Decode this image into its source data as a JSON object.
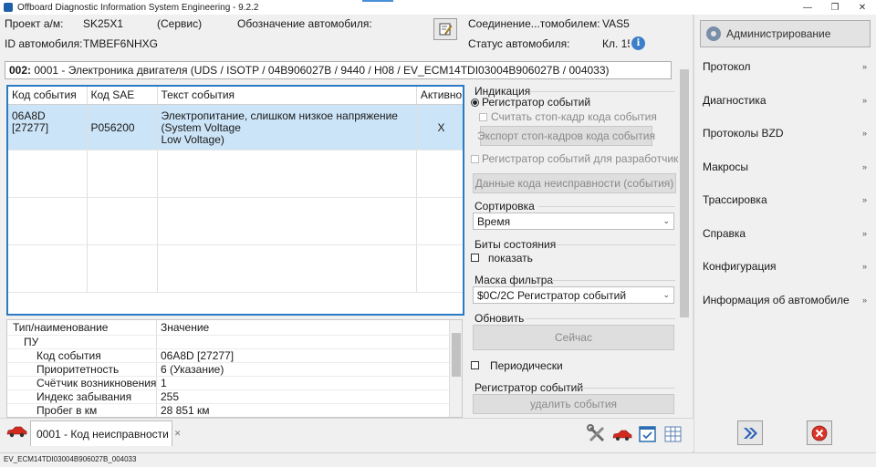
{
  "window": {
    "title": "Offboard Diagnostic Information System Engineering - 9.2.2",
    "minimize": "—",
    "restore": "❐",
    "close": "✕"
  },
  "header": {
    "project_label": "Проект а/м:",
    "project_value": "SK25X1",
    "project_mode": "(Сервис)",
    "designation_label": "Обозначение автомобиля:",
    "vehicle_id_label": "ID автомобиля:",
    "vehicle_id_value": "TMBEF6NHXG",
    "connection_label": "Соединение...томобилем:",
    "connection_value": "VAS5",
    "status_label": "Статус автомобиля:",
    "status_value": "Кл. 15",
    "info_glyph": "i"
  },
  "module_path": {
    "number": "002:",
    "text": "0001 - Электроника двигателя  (UDS / ISOTP / 04B906027B / 9440 / H08 / EV_ECM14TDI03004B906027B / 004033)"
  },
  "events_table": {
    "columns": [
      "Код события",
      "Код SAE",
      "Текст события",
      "Активно"
    ],
    "rows": [
      {
        "code_line1": "06A8D",
        "code_line2": "[27277]",
        "sae": "P056200",
        "text_line1": "Электропитание, слишком низкое напряжение",
        "text_line2": "(System Voltage",
        "text_line3": "Low Voltage)",
        "active": "X"
      }
    ]
  },
  "details_table": {
    "col1": "Тип/наименование",
    "col2": "Значение",
    "group": "ПУ",
    "rows": [
      {
        "name": "Код события",
        "value": "06A8D [27277]"
      },
      {
        "name": "Приоритетность",
        "value": "6 (Указание)"
      },
      {
        "name": "Счётчик возникновения от",
        "value": "1"
      },
      {
        "name": "Индекс забывания",
        "value": "255"
      },
      {
        "name": "Пробег в км",
        "value": "28 851 км"
      }
    ]
  },
  "options": {
    "indication_label": "Индикация",
    "event_recorder": "Регистратор событий",
    "read_freeze_frame": "Считать стоп-кадр кода события",
    "export_freeze_frames": "Экспорт стоп-кадров кода события",
    "dev_recorder": "Регистратор событий для разработчиков",
    "fault_data": "Данные кода неисправности (события)",
    "sort_label": "Сортировка",
    "sort_value": "Время",
    "status_bits_label": "Биты состояния",
    "show_label": "показать",
    "filter_mask_label": "Маска фильтра",
    "filter_mask_value": "$0C/2C Регистратор событий",
    "refresh_label": "Обновить",
    "now_button": "Сейчас",
    "periodic_label": "Периодически",
    "recorder_group_label": "Регистратор событий",
    "delete_events": "удалить события",
    "combo_arrow": "⌄"
  },
  "sidebar": {
    "admin_button": "Администрирование",
    "chevron": "»",
    "items": [
      "Протокол",
      "Диагностика",
      "Протоколы BZD",
      "Макросы",
      "Трассировка",
      "Справка",
      "Конфигурация",
      "Информация об автомобиле"
    ]
  },
  "tabs": {
    "active_tab": "0001 - Код неисправности",
    "tab_close": "✕"
  },
  "status_bar": {
    "text": "EV_ECM14TDI03004B906027B_004033"
  },
  "colors": {
    "selection": "#cce4f7",
    "table_border": "#2b7bc4",
    "accent": "#3d7ec9"
  }
}
